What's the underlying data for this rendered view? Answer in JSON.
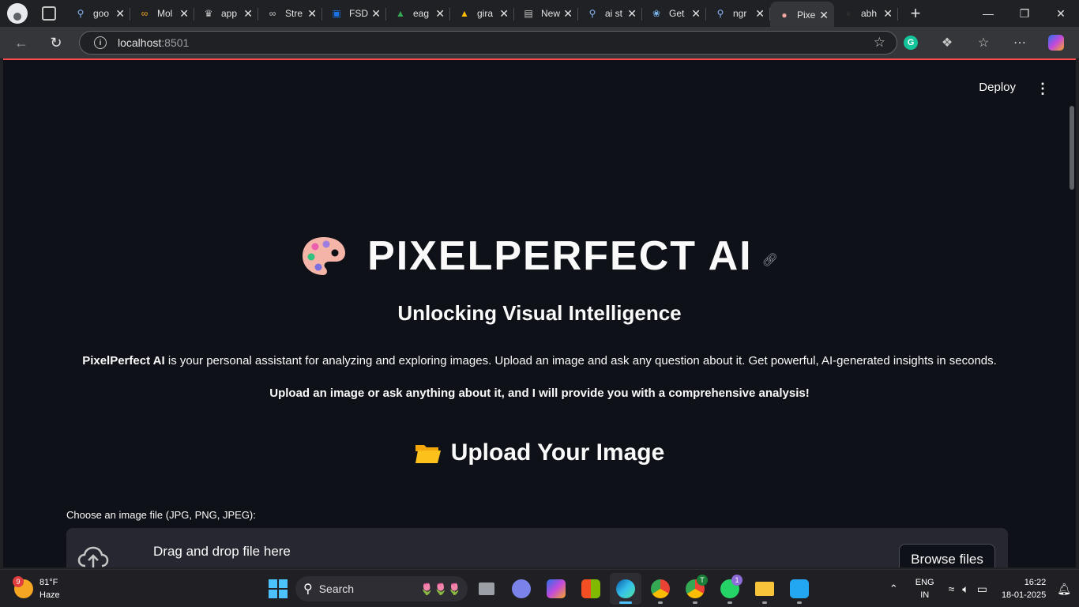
{
  "browser": {
    "tabs": [
      {
        "title": "goo",
        "icon": "search-icon",
        "color": "#8ab4f8"
      },
      {
        "title": "Mol",
        "icon": "infinity-icon",
        "color": "#f5a623"
      },
      {
        "title": "app",
        "icon": "crown-icon",
        "color": "#c4c7c5"
      },
      {
        "title": "Stre",
        "icon": "infinity-icon",
        "color": "#c4c7c5"
      },
      {
        "title": "FSD",
        "icon": "person-icon",
        "color": "#1a73e8"
      },
      {
        "title": "eag",
        "icon": "drive-icon",
        "color": "#34a853"
      },
      {
        "title": "gira",
        "icon": "drive-icon",
        "color": "#fbbc04"
      },
      {
        "title": "New",
        "icon": "calendar-icon",
        "color": "#c4c7c5"
      },
      {
        "title": "ai st",
        "icon": "search-icon",
        "color": "#8ab4f8"
      },
      {
        "title": "Get",
        "icon": "butterfly-icon",
        "color": "#7ab8f0"
      },
      {
        "title": "ngr",
        "icon": "search-icon",
        "color": "#8ab4f8"
      },
      {
        "title": "Pixe",
        "icon": "palette-icon",
        "color": "#f4a7a0",
        "active": true
      },
      {
        "title": "abh",
        "icon": "github-icon",
        "color": "#2b2b2b"
      }
    ],
    "url_host": "localhost",
    "url_port": ":8501"
  },
  "app": {
    "deploy_label": "Deploy",
    "kebab": "⋮",
    "title": "PIXELPERFECT AI",
    "subtitle": "Unlocking Visual Intelligence",
    "desc_bold": "PixelPerfect AI",
    "desc_rest": " is your personal assistant for analyzing and exploring images. Upload an image and ask any question about it. Get powerful, AI-generated insights in seconds.",
    "desc2": "Upload an image or ask anything about it, and I will provide you with a comprehensive analysis!",
    "upload_heading": "Upload Your Image",
    "file_label": "Choose an image file (JPG, PNG, JPEG):",
    "drop_text": "Drag and drop file here",
    "browse_label": "Browse files"
  },
  "taskbar": {
    "weather_badge": "9",
    "temperature": "81°F",
    "condition": "Haze",
    "search_label": "Search",
    "lang_line1": "ENG",
    "lang_line2": "IN",
    "time": "16:22",
    "date": "18-01-2025",
    "whatsapp_badge": "1",
    "chrome_badge": "T"
  }
}
